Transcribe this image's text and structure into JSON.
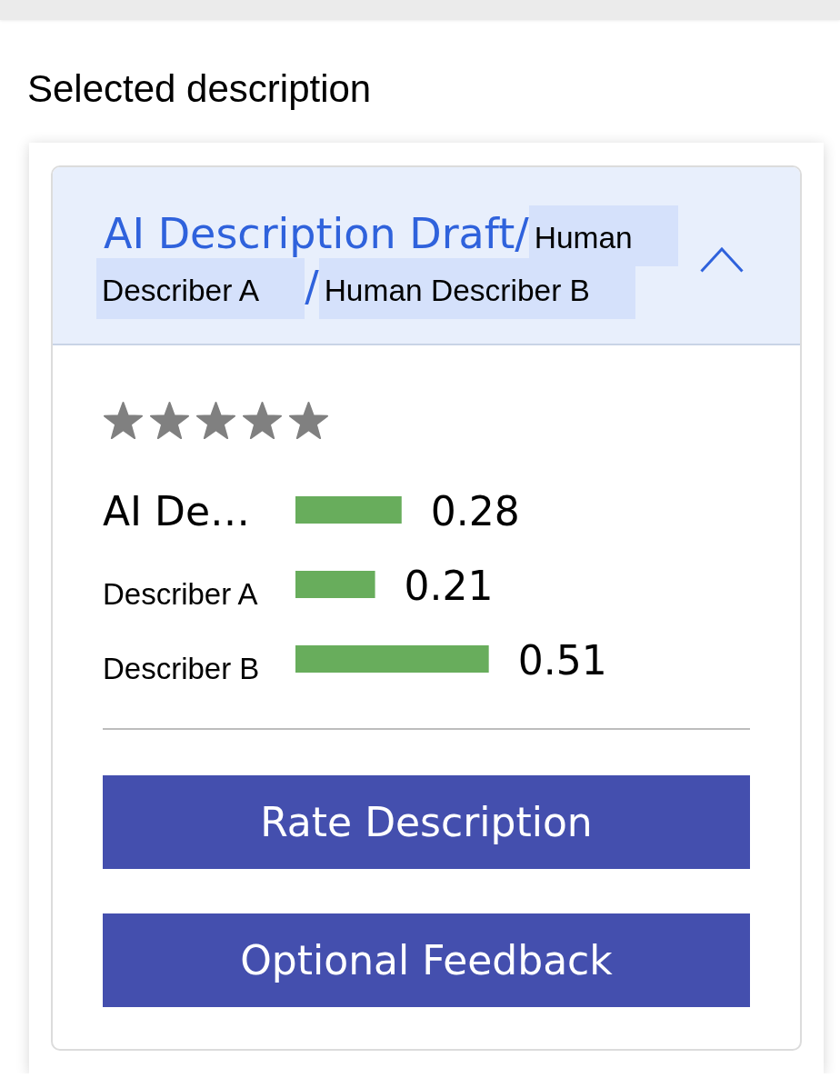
{
  "page": {
    "heading": "Selected description"
  },
  "panel": {
    "expanded": true,
    "title_parts": [
      {
        "kind": "title",
        "text": "AI Description Draft/"
      },
      {
        "kind": "tag",
        "text": "Human Describer A"
      },
      {
        "kind": "title",
        "text": "/"
      },
      {
        "kind": "tag",
        "text": "Human Describer B"
      }
    ],
    "rating": {
      "stars": 5
    },
    "chart_data": {
      "type": "bar",
      "orientation": "horizontal",
      "categories": [
        "AI De…",
        "Describer A",
        "Describer B"
      ],
      "values": [
        0.28,
        0.21,
        0.51
      ],
      "data_labels": true
    },
    "buttons": [
      "Rate Description",
      "Optional Feedback"
    ]
  }
}
